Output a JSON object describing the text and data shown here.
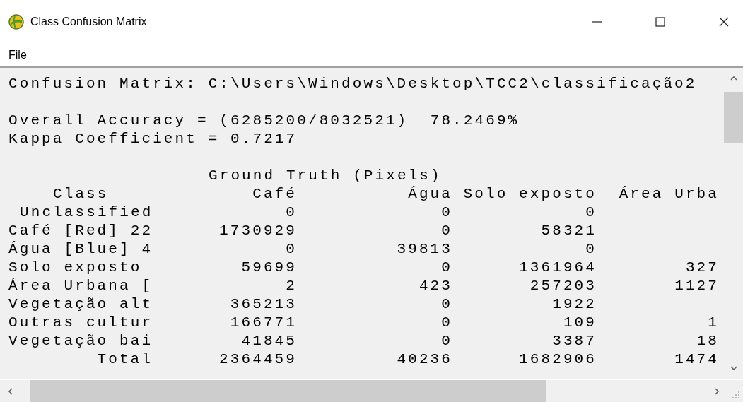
{
  "window": {
    "title": "Class Confusion Matrix"
  },
  "menu": [
    {
      "label": "File"
    }
  ],
  "report": {
    "source": "Confusion Matrix: C:\\Users\\Windows\\Desktop\\TCC2\\classificação2",
    "overall_accuracy": "Overall Accuracy = (6285200/8032521)  78.2469%",
    "kappa": "Kappa Coefficient = 0.7217",
    "table": {
      "caption": "Ground Truth (Pixels)",
      "columns": [
        "Class",
        "Café",
        "Água",
        "Solo exposto",
        "Área Urba"
      ],
      "rows": [
        {
          "kind": "unclassified",
          "cells": [
            "Unclassified",
            "0",
            "0",
            "0",
            null
          ]
        },
        {
          "kind": "class",
          "cells": [
            "Café [Red] 22",
            "1730929",
            "0",
            "58321",
            null
          ]
        },
        {
          "kind": "class",
          "cells": [
            "Água [Blue] 4",
            "0",
            "39813",
            "0",
            null
          ]
        },
        {
          "kind": "class",
          "cells": [
            "Solo exposto",
            "59699",
            "0",
            "1361964",
            "327"
          ]
        },
        {
          "kind": "class",
          "cells": [
            "Área Urbana [",
            "2",
            "423",
            "257203",
            "1127"
          ]
        },
        {
          "kind": "class",
          "cells": [
            "Vegetação alt",
            "365213",
            "0",
            "1922",
            null
          ]
        },
        {
          "kind": "class",
          "cells": [
            "Outras cultur",
            "166771",
            "0",
            "109",
            "1"
          ]
        },
        {
          "kind": "class",
          "cells": [
            "Vegetação bai",
            "41845",
            "0",
            "3387",
            "18"
          ]
        },
        {
          "kind": "total",
          "cells": [
            "Total",
            "2364459",
            "40236",
            "1682906",
            "1474"
          ]
        }
      ]
    }
  }
}
